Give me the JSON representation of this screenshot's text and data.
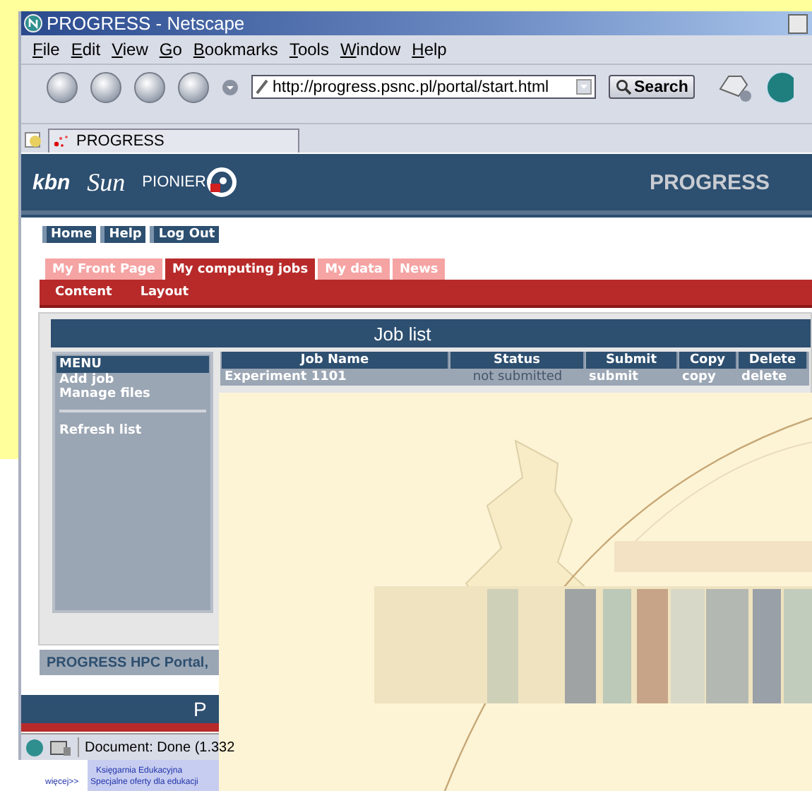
{
  "window": {
    "title": "PROGRESS - Netscape"
  },
  "menu": [
    {
      "label": "File"
    },
    {
      "label": "Edit"
    },
    {
      "label": "View"
    },
    {
      "label": "Go"
    },
    {
      "label": "Bookmarks"
    },
    {
      "label": "Tools"
    },
    {
      "label": "Window"
    },
    {
      "label": "Help"
    }
  ],
  "toolbar": {
    "address": "http://progress.psnc.pl/portal/start.html",
    "search_button": "Search"
  },
  "browser_tab": {
    "label": "PROGRESS"
  },
  "portal": {
    "logos": [
      "kbn",
      "Sun",
      "PIONIER"
    ],
    "brand": "PROGRESS",
    "top_links": [
      "Home",
      "Help",
      "Log Out"
    ],
    "tabs": [
      {
        "label": "My Front Page",
        "selected": false
      },
      {
        "label": "My computing jobs",
        "selected": true
      },
      {
        "label": "My data",
        "selected": false
      },
      {
        "label": "News",
        "selected": false
      }
    ],
    "subtabs": [
      "Content",
      "Layout"
    ],
    "panel_title": "Job list",
    "side_menu": {
      "title": "MENU",
      "groups": [
        [
          "Add job",
          "Manage files"
        ],
        [
          "Refresh list"
        ]
      ]
    },
    "table": {
      "columns": [
        "Job Name",
        "Status",
        "Submit",
        "Copy",
        "Delete"
      ],
      "rows": [
        {
          "job_name": "Experiment 1101",
          "status": "not submitted",
          "submit": "submit",
          "copy": "copy",
          "delete": "delete"
        }
      ]
    },
    "footer": "PROGRESS HPC Portal,",
    "bottom_bar": "P"
  },
  "status_bar": "Document: Done (1.332",
  "background_window": {
    "texts": [
      "Księgarnia Edukacyjna",
      "więcej>>",
      "Specjalne oferty dla edukacji"
    ]
  }
}
